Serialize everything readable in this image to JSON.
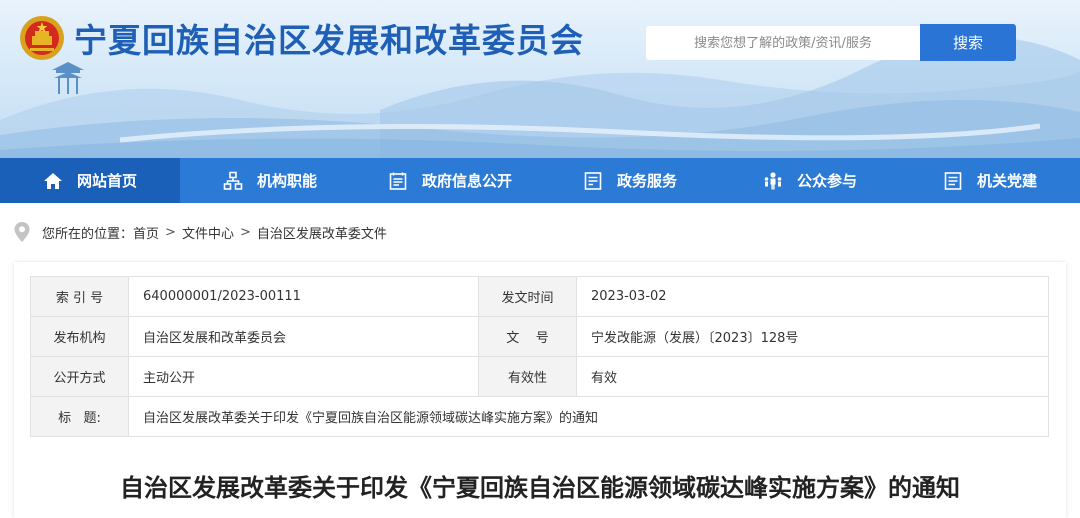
{
  "header": {
    "site_title": "宁夏回族自治区发展和改革委员会",
    "search_placeholder": "搜索您想了解的政策/资讯/服务",
    "search_button": "搜索"
  },
  "nav": {
    "items": [
      {
        "label": "网站首页",
        "icon": "home-icon"
      },
      {
        "label": "机构职能",
        "icon": "org-chart-icon"
      },
      {
        "label": "政府信息公开",
        "icon": "document-list-icon"
      },
      {
        "label": "政务服务",
        "icon": "service-list-icon"
      },
      {
        "label": "公众参与",
        "icon": "people-icon"
      },
      {
        "label": "机关党建",
        "icon": "party-building-icon"
      }
    ],
    "active_index": 0
  },
  "breadcrumb": {
    "prefix": "您所在的位置：",
    "items": [
      "首页",
      "文件中心",
      "自治区发展改革委文件"
    ],
    "separator": ">"
  },
  "meta_table": {
    "rows": [
      [
        {
          "label": "索 引 号",
          "value": "640000001/2023-00111"
        },
        {
          "label": "发文时间",
          "value": "2023-03-02"
        }
      ],
      [
        {
          "label": "发布机构",
          "value": "自治区发展和改革委员会"
        },
        {
          "label": "文    号",
          "value": "宁发改能源（发展）〔2023〕128号"
        }
      ],
      [
        {
          "label": "公开方式",
          "value": "主动公开"
        },
        {
          "label": "有效性",
          "value": "有效"
        }
      ]
    ],
    "title_row": {
      "label": "标   题:",
      "value": "自治区发展改革委关于印发《宁夏回族自治区能源领域碳达峰实施方案》的通知"
    }
  },
  "document": {
    "title": "自治区发展改革委关于印发《宁夏回族自治区能源领域碳达峰实施方案》的通知"
  },
  "colors": {
    "nav_bg": "#2b7ad6",
    "nav_active": "#1a5fb8",
    "title_blue": "#1f5fb5",
    "button_blue": "#2a74d5"
  }
}
